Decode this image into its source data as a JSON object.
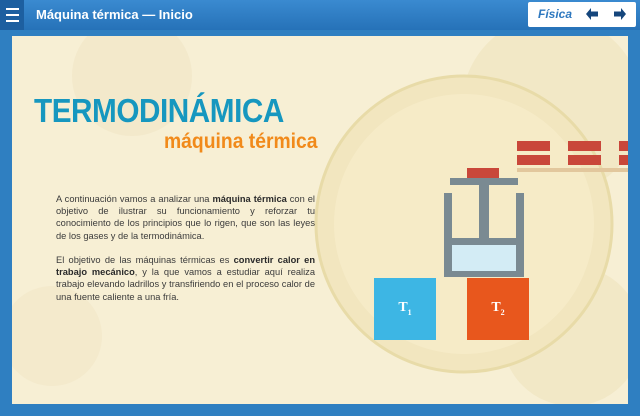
{
  "header": {
    "title": "Máquina térmica — Inicio",
    "subject": "Física",
    "prev_icon": "arrow-left-icon",
    "next_icon": "arrow-right-icon",
    "menu_icon": "hamburger-menu-icon"
  },
  "content": {
    "heading": "TERMODINÁMICA",
    "subheading": "máquina térmica",
    "paragraph1": {
      "before": "A continuación vamos a analizar una ",
      "bold": "máquina térmica",
      "after": " con el objetivo de ilustrar su funcionamiento y reforzar tu conocimiento de los principios que lo rigen, que son las leyes de los gases y de la termodinámica."
    },
    "paragraph2": {
      "before": "El objetivo de las máquinas térmicas es ",
      "bold": "convertir calor en trabajo mecánico",
      "after": ", y la que vamos a estudiar aquí realiza trabajo elevando ladrillos y transfiriendo en el proceso calor de una fuente caliente a una fría."
    }
  },
  "diagram": {
    "cold_source": {
      "label": "T",
      "subscript": "1",
      "color": "#3db6e4"
    },
    "hot_source": {
      "label": "T",
      "subscript": "2",
      "color": "#e8571d"
    }
  },
  "colors": {
    "header": "#2f7fc1",
    "heading": "#1697bf",
    "subheading": "#f18a1a",
    "background": "#f7efd4",
    "brick": "#c9473a"
  }
}
